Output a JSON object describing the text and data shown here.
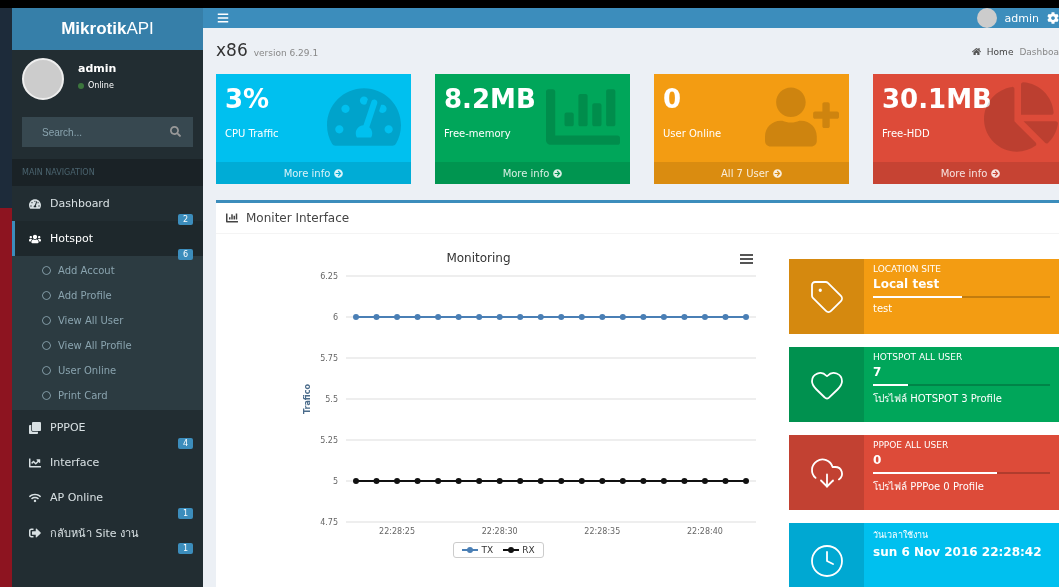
{
  "brand": {
    "bold": "Mikrotik",
    "light": "API"
  },
  "header": {
    "user": "admin"
  },
  "sidebar": {
    "user": {
      "name": "admin",
      "status": "Online"
    },
    "search": {
      "placeholder": "Search..."
    },
    "section": "MAIN NAVIGATION",
    "items": [
      {
        "label": "Dashboard",
        "badge": "2",
        "selected": false
      },
      {
        "label": "Hotspot",
        "badge": "6",
        "selected": true,
        "children": [
          {
            "label": "Add Accout"
          },
          {
            "label": "Add Profile"
          },
          {
            "label": "View All User"
          },
          {
            "label": "View All Profile"
          },
          {
            "label": "User Online"
          },
          {
            "label": "Print Card"
          }
        ]
      },
      {
        "label": "PPPOE",
        "badge": "4",
        "selected": false
      },
      {
        "label": "Interface",
        "selected": false
      },
      {
        "label": "AP Online",
        "badge": "1",
        "selected": false
      },
      {
        "label": "กลับหน้า Site งาน",
        "badge": "1",
        "selected": false
      }
    ]
  },
  "page": {
    "title": "x86",
    "subtitle": "version 6.29.1",
    "breadcrumb": [
      "Home",
      "Dashboa"
    ]
  },
  "stat_boxes": [
    {
      "value": "3%",
      "label": "CPU Traffic",
      "link": "More info",
      "color": "#00c0ef"
    },
    {
      "value": "8.2MB",
      "label": "Free-memory",
      "link": "More info",
      "color": "#00a65a"
    },
    {
      "value": "0",
      "label": "User Online",
      "link": "All 7 User",
      "color": "#f39c12"
    },
    {
      "value": "30.1MB",
      "label": "Free-HDD",
      "link": "More info",
      "color": "#dd4b39"
    }
  ],
  "panel": {
    "title": "Moniter Interface",
    "chart_data": {
      "type": "line",
      "title": "Monitoring",
      "ylabel": "Trafico",
      "categories": [
        null,
        null,
        "22:28:25",
        null,
        null,
        null,
        null,
        "22:28:30",
        null,
        null,
        null,
        null,
        "22:28:35",
        null,
        null,
        null,
        null,
        "22:28:40",
        null,
        null
      ],
      "grid": true,
      "series": [
        {
          "name": "TX",
          "color": "#4a7fb5",
          "marker": "circle",
          "values": [
            6,
            6,
            6,
            6,
            6,
            6,
            6,
            6,
            6,
            6,
            6,
            6,
            6,
            6,
            6,
            6,
            6,
            6,
            6,
            6
          ]
        },
        {
          "name": "RX",
          "color": "#111111",
          "marker": "circle",
          "values": [
            5,
            5,
            5,
            5,
            5,
            5,
            5,
            5,
            5,
            5,
            5,
            5,
            5,
            5,
            5,
            5,
            5,
            5,
            5,
            5
          ]
        }
      ],
      "ylim": [
        4.75,
        6.25
      ],
      "yticks": [
        4.75,
        5,
        5.25,
        5.5,
        5.75,
        6,
        6.25
      ]
    },
    "info_boxes": [
      {
        "label": "LOCATION SITE",
        "value": "Local test",
        "description": "test",
        "level": 0.5,
        "color": "#f39c12"
      },
      {
        "label": "HOTSPOT ALL USER",
        "value": "7",
        "description": "โปรไฟล์ HOTSPOT 3 Profile",
        "level": 0.2,
        "color": "#00a65a"
      },
      {
        "label": "PPPOE ALL USER",
        "value": "0",
        "description": "โปรไฟล์ PPPoe 0 Profile",
        "level": 0.7,
        "color": "#dd4b39"
      },
      {
        "label": "วันเวลาใช้งาน",
        "value": "sun 6 Nov 2016 22:28:42",
        "color": "#00c0ef"
      }
    ]
  }
}
